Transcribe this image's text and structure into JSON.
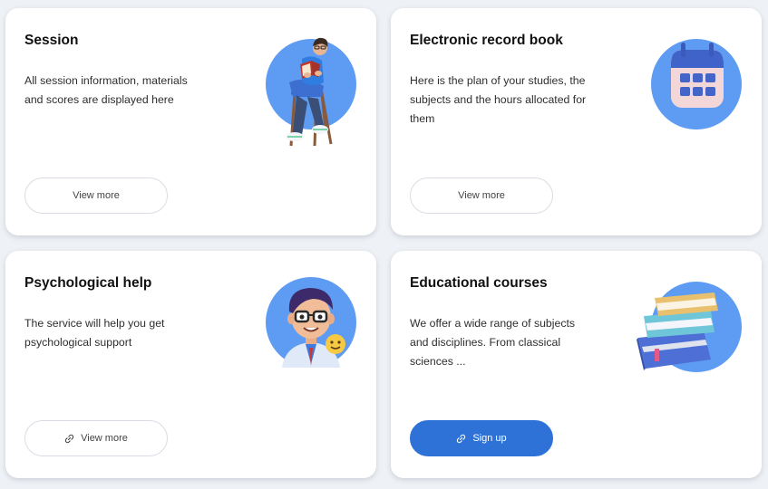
{
  "cards": [
    {
      "title": "Session",
      "description": "All session information, materials and scores are displayed here",
      "button": {
        "label": "View more",
        "icon": "none",
        "style": "outline"
      },
      "illustration": "student-reading-in-chair"
    },
    {
      "title": "Electronic record book",
      "description": "Here is the plan of your studies, the subjects and the hours allocated for them",
      "button": {
        "label": "View more",
        "icon": "none",
        "style": "outline"
      },
      "illustration": "calendar-icon"
    },
    {
      "title": "Psychological help",
      "description": "The service will help you get psychological support",
      "button": {
        "label": "View more",
        "icon": "link-icon",
        "style": "outline"
      },
      "illustration": "psychologist-avatar"
    },
    {
      "title": "Educational courses",
      "description": "We offer a wide range of subjects and disciplines. From classical sciences ...",
      "button": {
        "label": "Sign up",
        "icon": "link-icon",
        "style": "primary"
      },
      "illustration": "book-stack"
    }
  ],
  "colors": {
    "accent": "#2e72d8",
    "illustration_circle": "#5e9bf2",
    "page_background": "#eef1f5",
    "card_background": "#ffffff"
  }
}
